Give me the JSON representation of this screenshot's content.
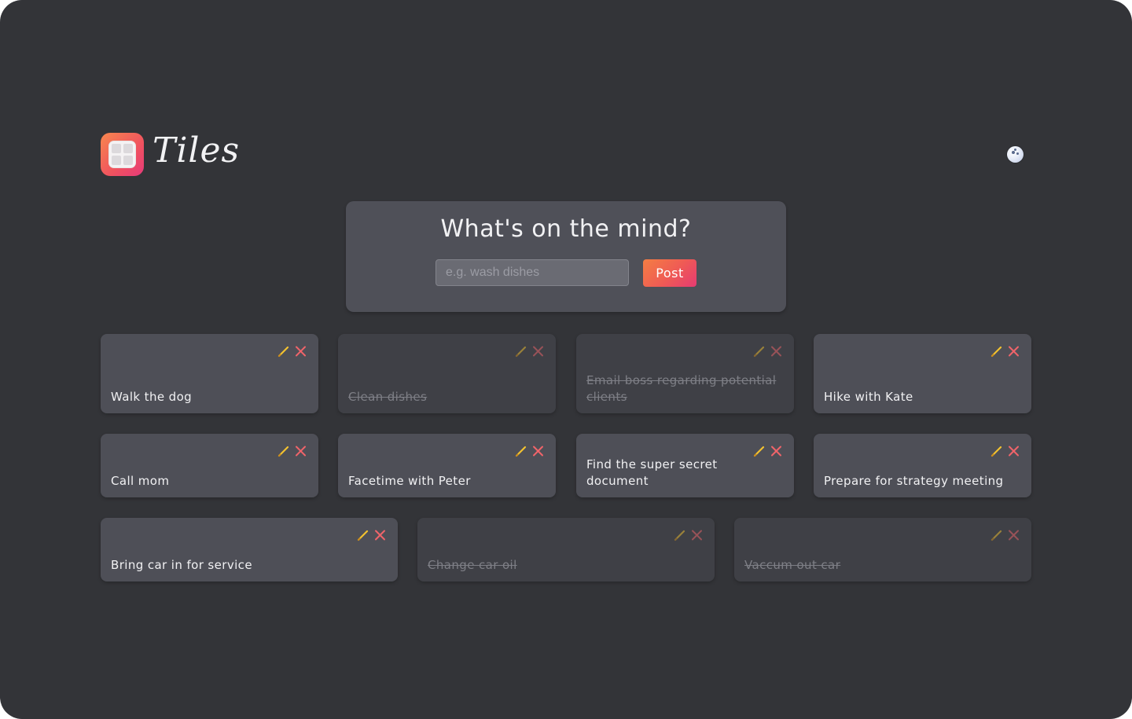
{
  "app": {
    "title": "Tiles",
    "theme_icon": "moon-icon",
    "accent": "#ef5a55",
    "edit_color": "#f2c230",
    "delete_color": "#f0646a"
  },
  "composer": {
    "title": "What's on the mind?",
    "input_value": "",
    "input_placeholder": "e.g. wash dishes",
    "post_label": "Post"
  },
  "tiles": [
    {
      "text": "Walk the dog",
      "done": false
    },
    {
      "text": "Clean dishes",
      "done": true
    },
    {
      "text": "Email boss regarding potential clients",
      "done": true
    },
    {
      "text": "Hike with Kate",
      "done": false
    },
    {
      "text": "Call mom",
      "done": false
    },
    {
      "text": "Facetime with Peter",
      "done": false
    },
    {
      "text": "Find the super secret document",
      "done": false
    },
    {
      "text": "Prepare for strategy meeting",
      "done": false
    },
    {
      "text": "Bring car in for service",
      "done": false
    },
    {
      "text": "Change car oil",
      "done": true
    },
    {
      "text": "Vaccum out car",
      "done": true
    }
  ]
}
